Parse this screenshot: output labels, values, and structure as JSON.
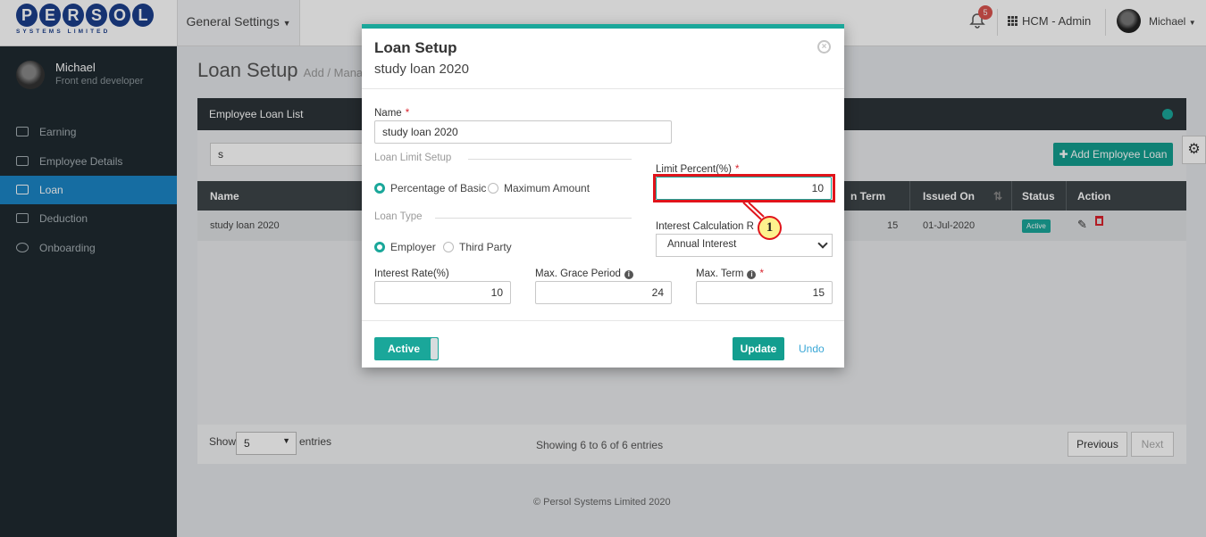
{
  "header": {
    "logo_letters": [
      "P",
      "E",
      "R",
      "S",
      "O",
      "L"
    ],
    "logo_sub": "SYSTEMS LIMITED",
    "menu_label": "General Settings",
    "notification_count": "5",
    "app_label": "HCM - Admin",
    "user_name": "Michael"
  },
  "sidebar": {
    "user_name": "Michael",
    "user_role": "Front end developer",
    "items": [
      {
        "label": "Earning",
        "active": false
      },
      {
        "label": "Employee Details",
        "active": false
      },
      {
        "label": "Loan",
        "active": true
      },
      {
        "label": "Deduction",
        "active": false
      },
      {
        "label": "Onboarding",
        "active": false
      }
    ]
  },
  "page": {
    "title": "Loan Setup",
    "subtitle": "Add / Mana",
    "panel_title": "Employee Loan List",
    "search_value": "s",
    "add_button": "Add Employee Loan",
    "columns": {
      "name": "Name",
      "term": "n Term",
      "issued_on": "Issued On",
      "status": "Status",
      "action": "Action"
    },
    "row": {
      "name": "study loan 2020",
      "term": "15",
      "issued_on": "01-Jul-2020",
      "status": "Active"
    },
    "show_label": "Show",
    "show_value": "5",
    "entries_label": "entries",
    "showing_text": "Showing 6 to 6 of 6 entries",
    "previous": "Previous",
    "next": "Next",
    "footer": "© Persol Systems Limited 2020"
  },
  "modal": {
    "title": "Loan Setup",
    "subtitle": "study loan 2020",
    "name_label": "Name",
    "name_value": "study loan 2020",
    "loan_limit_section": "Loan Limit Setup",
    "limit_options": [
      "Percentage of Basic",
      "Maximum Amount"
    ],
    "limit_selected": 0,
    "limit_percent_label": "Limit Percent(%)",
    "limit_percent_value": "10",
    "loan_type_section": "Loan Type",
    "type_options": [
      "Employer",
      "Third Party"
    ],
    "type_selected": 0,
    "interest_calc_label": "Interest Calculation R",
    "interest_calc_value": "Annual Interest",
    "interest_rate_label": "Interest Rate(%)",
    "interest_rate_value": "10",
    "grace_label": "Max. Grace Period",
    "grace_value": "24",
    "term_label": "Max. Term",
    "term_value": "15",
    "active_toggle": "Active",
    "update_button": "Update",
    "undo_link": "Undo"
  },
  "annotation": {
    "callout_number": "1",
    "color": "#e0141b"
  }
}
